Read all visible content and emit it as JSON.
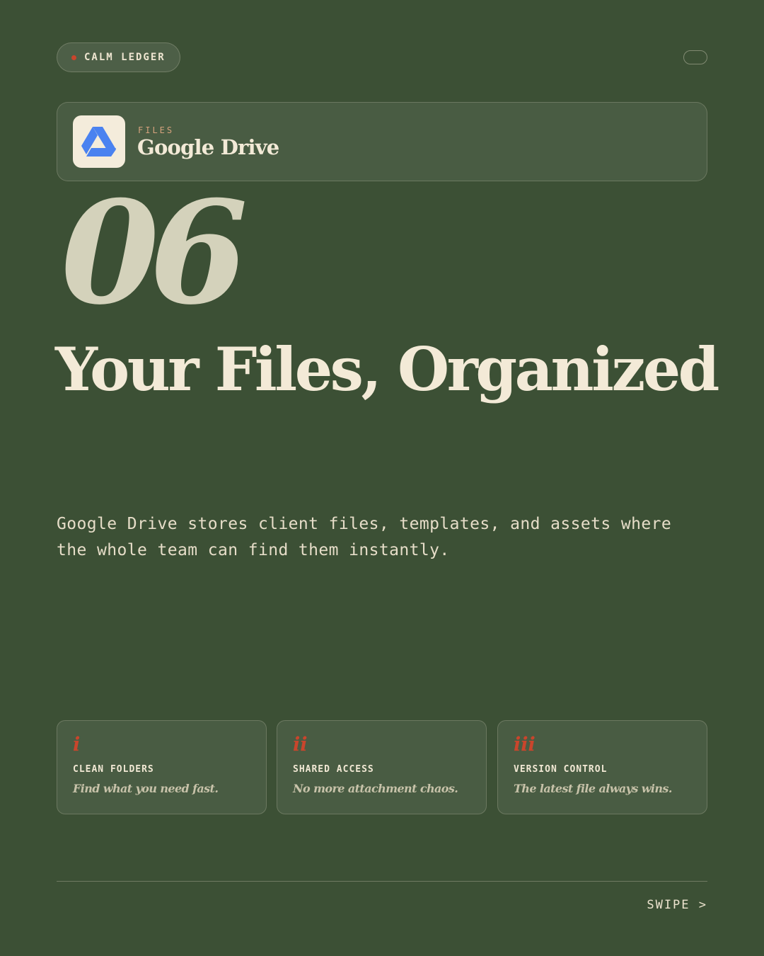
{
  "brand": {
    "name": "CALM LEDGER",
    "dot_color": "#c9452c"
  },
  "app_card": {
    "category": "FILES",
    "name": "Google Drive",
    "icon": "google-drive-icon"
  },
  "slide_number": "06",
  "headline": "Your Files, Organized",
  "description": "Google Drive stores client files, templates, and assets where the whole team can find them instantly.",
  "features": [
    {
      "numeral": "i",
      "title": "CLEAN FOLDERS",
      "desc": "Find what you need fast."
    },
    {
      "numeral": "ii",
      "title": "SHARED ACCESS",
      "desc": "No more attachment chaos."
    },
    {
      "numeral": "iii",
      "title": "VERSION CONTROL",
      "desc": "The latest file always wins."
    }
  ],
  "footer": {
    "swipe_label": "SWIPE >"
  },
  "colors": {
    "background": "#3c5035",
    "accent": "#c9452c",
    "cream": "#f3ead7",
    "drive_blue": "#4a82f0"
  }
}
